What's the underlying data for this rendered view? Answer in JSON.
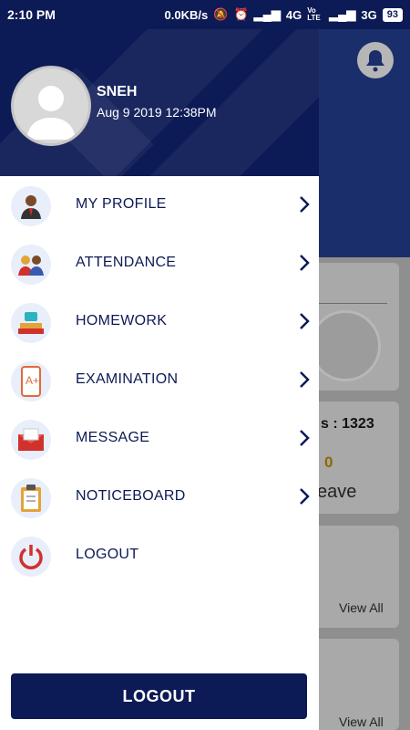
{
  "status_bar": {
    "time": "2:10 PM",
    "speed": "0.0KB/s",
    "net1": "4G",
    "net2": "3G",
    "volte": "Vo LTE",
    "battery": "93"
  },
  "drawer": {
    "user": {
      "name": "SNEH",
      "date": "Aug  9 2019 12:38PM"
    },
    "items": [
      {
        "label": "MY PROFILE",
        "icon": "profile-icon"
      },
      {
        "label": "ATTENDANCE",
        "icon": "attendance-icon"
      },
      {
        "label": "HOMEWORK",
        "icon": "homework-icon"
      },
      {
        "label": "EXAMINATION",
        "icon": "examination-icon"
      },
      {
        "label": "MESSAGE",
        "icon": "message-icon"
      },
      {
        "label": "NOTICEBOARD",
        "icon": "noticeboard-icon"
      },
      {
        "label": "LOGOUT",
        "icon": "power-icon"
      }
    ],
    "logout_button": "LOGOUT"
  },
  "background": {
    "stat": "s : 1323",
    "zero": "0",
    "leave": "eave",
    "view_all_1": "View All",
    "view_all_2": "View All"
  }
}
